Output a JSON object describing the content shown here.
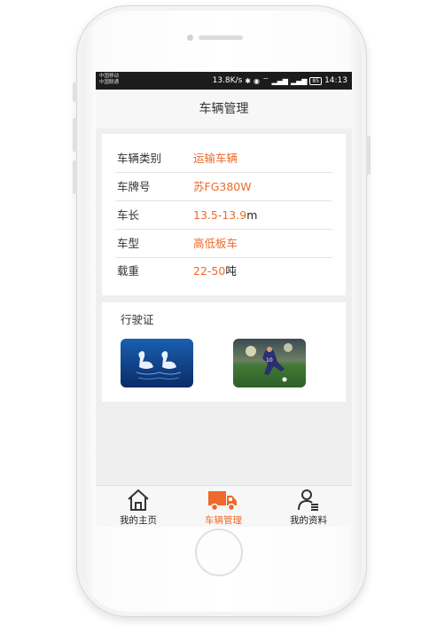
{
  "status_bar": {
    "carrier_1": "中国移动",
    "carrier_2": "中国联通",
    "speed": "13.8K/s",
    "battery": "85",
    "time": "14:13"
  },
  "header": {
    "title": "车辆管理"
  },
  "vehicle_info": [
    {
      "label": "车辆类别",
      "value": "运输车辆",
      "unit": ""
    },
    {
      "label": "车牌号",
      "value": "苏FG380W",
      "unit": ""
    },
    {
      "label": "车长",
      "value": "13.5-13.9",
      "unit": "m"
    },
    {
      "label": "车型",
      "value": "高低板车",
      "unit": ""
    },
    {
      "label": "载重",
      "value": "22-50",
      "unit": "吨"
    }
  ],
  "license": {
    "title": "行驶证",
    "photos": [
      "swans-photo",
      "soccer-photo"
    ]
  },
  "tabbar": {
    "items": [
      {
        "label": "我的主页",
        "icon": "home-icon",
        "active": false
      },
      {
        "label": "车辆管理",
        "icon": "truck-icon",
        "active": true
      },
      {
        "label": "我的资料",
        "icon": "profile-icon",
        "active": false
      }
    ]
  },
  "colors": {
    "accent": "#ee6a2a",
    "status_bar": "#1c1c1c",
    "screen_bg": "#efefef"
  }
}
